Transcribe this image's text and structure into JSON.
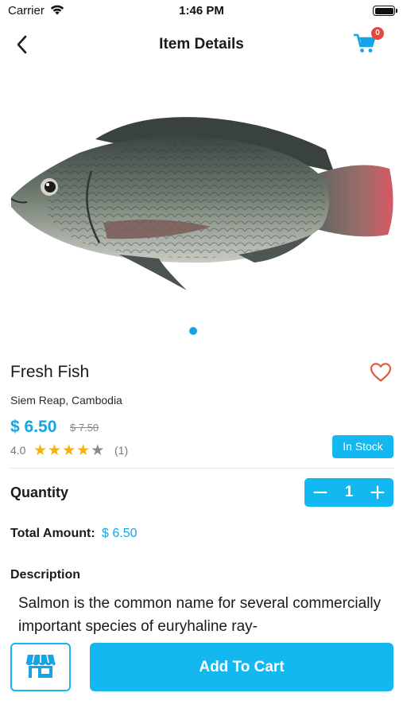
{
  "status_bar": {
    "carrier": "Carrier",
    "time": "1:46 PM"
  },
  "nav": {
    "title": "Item Details",
    "cart_count": "0"
  },
  "gallery": {
    "image": "fish-photo",
    "page_index": 0
  },
  "product": {
    "name": "Fresh Fish",
    "location": "Siem Reap, Cambodia",
    "price": "$ 6.50",
    "old_price": "$ 7.50",
    "rating": "4.0",
    "rating_value": 4,
    "rating_max": 5,
    "review_count": "(1)",
    "stock": "In Stock"
  },
  "quantity": {
    "label": "Quantity",
    "value": "1"
  },
  "total": {
    "label": "Total Amount:",
    "value": "$ 6.50"
  },
  "description": {
    "title": "Description",
    "text": "Salmon is the common name for several commercially important species of euryhaline ray-"
  },
  "actions": {
    "add_to_cart": "Add To Cart"
  },
  "colors": {
    "accent": "#14b8f0",
    "price": "#14a5e8",
    "badge": "#e8453c",
    "star": "#f5b301",
    "heart": "#e05a3f"
  },
  "icons": {
    "back": "chevron-left-icon",
    "cart": "cart-icon",
    "heart": "heart-icon",
    "store": "store-icon"
  }
}
